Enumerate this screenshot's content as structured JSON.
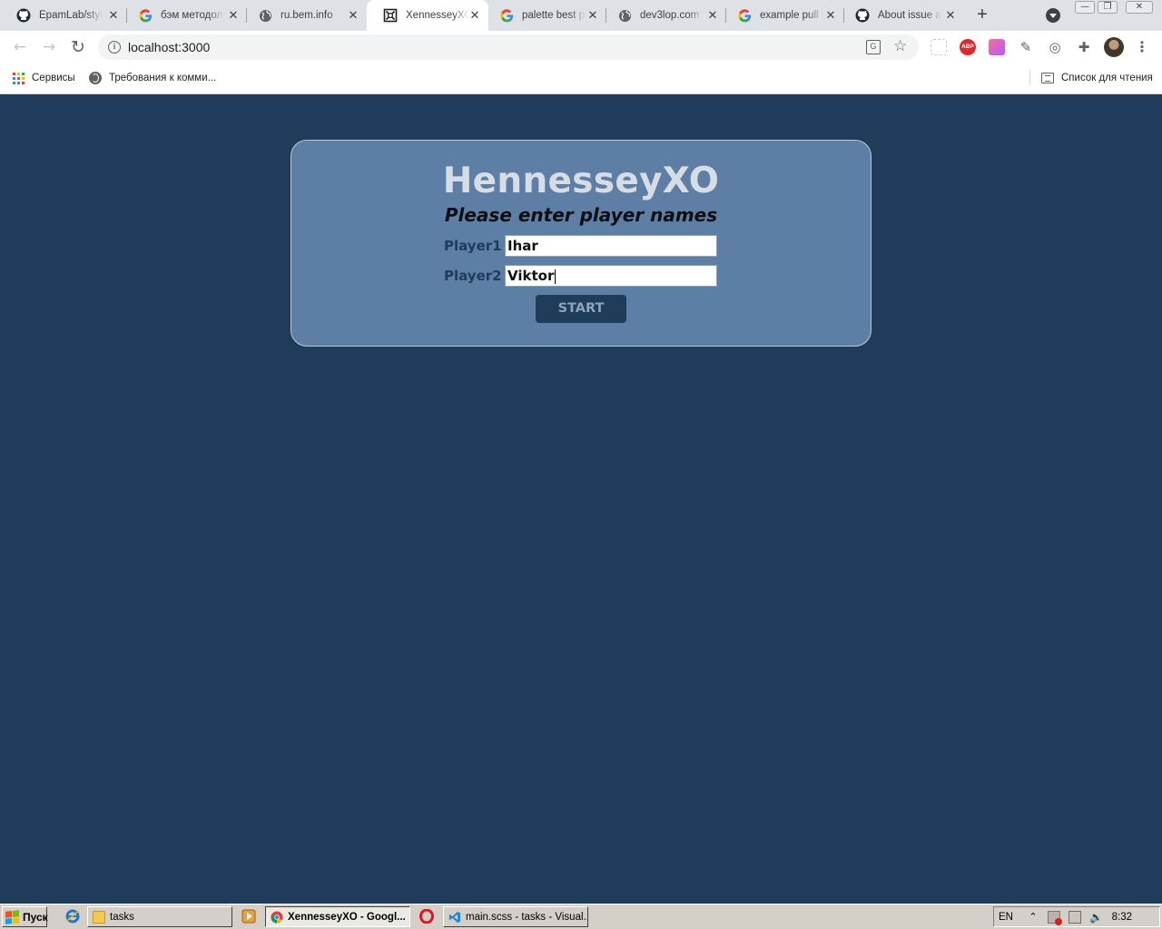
{
  "browser": {
    "tabs": [
      {
        "title": "EpamLab/style",
        "icon": "github-icon"
      },
      {
        "title": "бэм методолог",
        "icon": "google-icon"
      },
      {
        "title": "ru.bem.info",
        "icon": "globe-icon"
      },
      {
        "title": "XennesseyXO",
        "icon": "xo-favicon-icon"
      },
      {
        "title": "palette best p",
        "icon": "google-icon"
      },
      {
        "title": "dev3lop.com",
        "icon": "globe-icon"
      },
      {
        "title": "example pull r",
        "icon": "google-icon"
      },
      {
        "title": "About issue an",
        "icon": "github-icon"
      }
    ],
    "active_tab": 3,
    "new_tab_symbol": "+",
    "url": "localhost:3000",
    "extensions": [
      "apps-icon",
      "adblock-plus-icon",
      "color-extension-icon",
      "eyedropper-icon",
      "devtools-extension-icon",
      "puzzle-extensions-icon"
    ],
    "adblock_label": "ABP",
    "bookmarks": {
      "items": [
        {
          "label": "Сервисы",
          "icon": "apps-grid-icon"
        },
        {
          "label": "Требования к комми...",
          "icon": "globe-icon"
        }
      ],
      "reading_list": "Список для чтения"
    }
  },
  "game": {
    "title": "HennesseyXO",
    "subtitle": "Please enter player names",
    "player1_label": "Player1 :",
    "player1_value": "Ihar",
    "player2_label": "Player2 :",
    "player2_value": "Viktor",
    "start_label": "START"
  },
  "taskbar": {
    "start_label": "Пуск",
    "buttons": [
      {
        "label": "tasks",
        "icon": "folder-icon",
        "active": false
      },
      {
        "label": "XennesseyXO - Googl...",
        "icon": "chrome-icon",
        "active": true
      },
      {
        "label": "main.scss - tasks - Visual...",
        "icon": "vscode-icon",
        "active": false
      }
    ],
    "language": "EN",
    "clock": "8:32"
  },
  "colors": {
    "page_background": "#1f3c5b",
    "card_background": "#5e7fa5",
    "title_color": "#d8dde4",
    "button_background": "#1f3c5b",
    "button_text": "#8da4bc"
  }
}
